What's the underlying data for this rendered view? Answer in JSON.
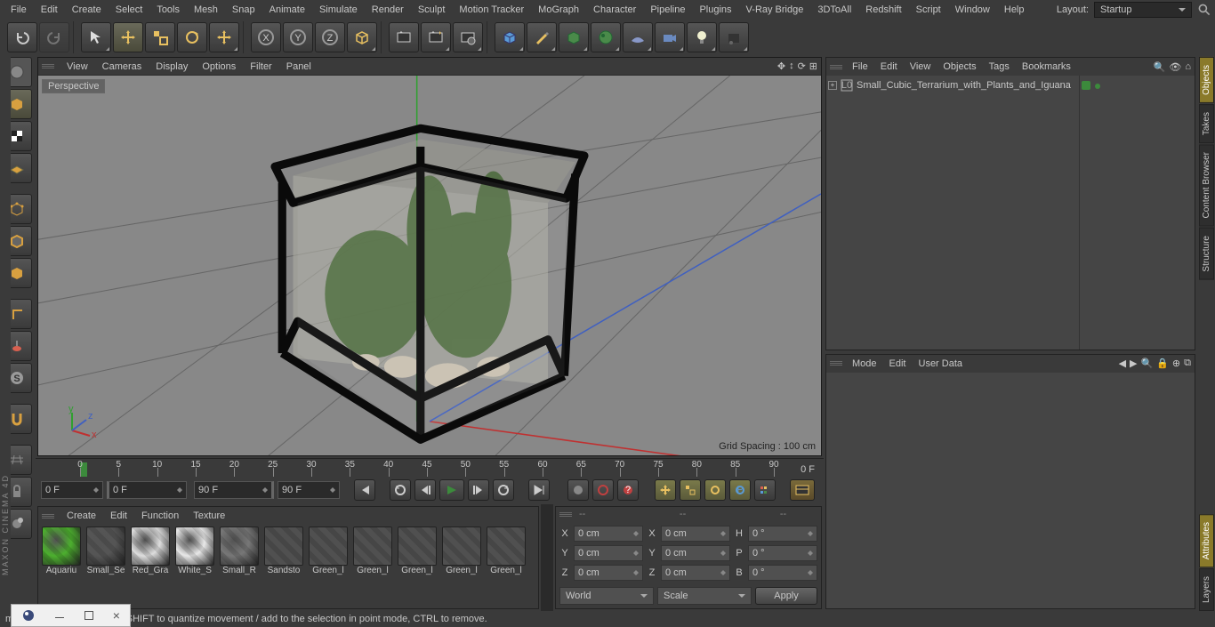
{
  "menu": [
    "File",
    "Edit",
    "Create",
    "Select",
    "Tools",
    "Mesh",
    "Snap",
    "Animate",
    "Simulate",
    "Render",
    "Sculpt",
    "Motion Tracker",
    "MoGraph",
    "Character",
    "Pipeline",
    "Plugins",
    "V-Ray Bridge",
    "3DToAll",
    "Redshift",
    "Script",
    "Window",
    "Help"
  ],
  "layout": {
    "label": "Layout:",
    "value": "Startup"
  },
  "viewport": {
    "menus": [
      "View",
      "Cameras",
      "Display",
      "Options",
      "Filter",
      "Panel"
    ],
    "label": "Perspective",
    "grid": "Grid Spacing : 100 cm"
  },
  "timeline": {
    "ticks": [
      0,
      5,
      10,
      15,
      20,
      25,
      30,
      35,
      40,
      45,
      50,
      55,
      60,
      65,
      70,
      75,
      80,
      85,
      90
    ],
    "end_label": "0 F",
    "start_field": "0 F",
    "range_start": "0 F",
    "range_end": "90 F",
    "end_field": "90 F"
  },
  "materials": {
    "menus": [
      "Create",
      "Edit",
      "Function",
      "Texture"
    ],
    "items": [
      "Aquariu",
      "Small_Se",
      "Red_Gra",
      "White_S",
      "Small_R",
      "Sandsto",
      "Green_l",
      "Green_l",
      "Green_l",
      "Green_l",
      "Green_l"
    ],
    "item_colors": [
      "#4caf2e",
      "#555",
      "#ddd",
      "#e8e8e8",
      "#777",
      "#a08860",
      "#5a7a3a",
      "#5a7a3a",
      "#5a7a3a",
      "#5a7a3a",
      "#5a7a3a"
    ],
    "filled_count": 5
  },
  "coords": {
    "heads": [
      "--",
      "--",
      "--"
    ],
    "rows": [
      {
        "a": "X",
        "av": "0 cm",
        "b": "X",
        "bv": "0 cm",
        "c": "H",
        "cv": "0 °"
      },
      {
        "a": "Y",
        "av": "0 cm",
        "b": "Y",
        "bv": "0 cm",
        "c": "P",
        "cv": "0 °"
      },
      {
        "a": "Z",
        "av": "0 cm",
        "b": "Z",
        "bv": "0 cm",
        "c": "B",
        "cv": "0 °"
      }
    ],
    "dd1": "World",
    "dd2": "Scale",
    "apply": "Apply"
  },
  "objects": {
    "menus": [
      "File",
      "Edit",
      "View",
      "Objects",
      "Tags",
      "Bookmarks"
    ],
    "item": "Small_Cubic_Terrarium_with_Plants_and_Iguana"
  },
  "attrs": {
    "menus": [
      "Mode",
      "Edit",
      "User Data"
    ]
  },
  "right_tabs_top": [
    "Objects",
    "Takes",
    "Content Browser",
    "Structure"
  ],
  "right_tabs_bottom": [
    "Attributes",
    "Layers"
  ],
  "status": "move elements. Hold down SHIFT to quantize movement / add to the selection in point mode, CTRL to remove.",
  "brand": "MAXON CINEMA 4D"
}
